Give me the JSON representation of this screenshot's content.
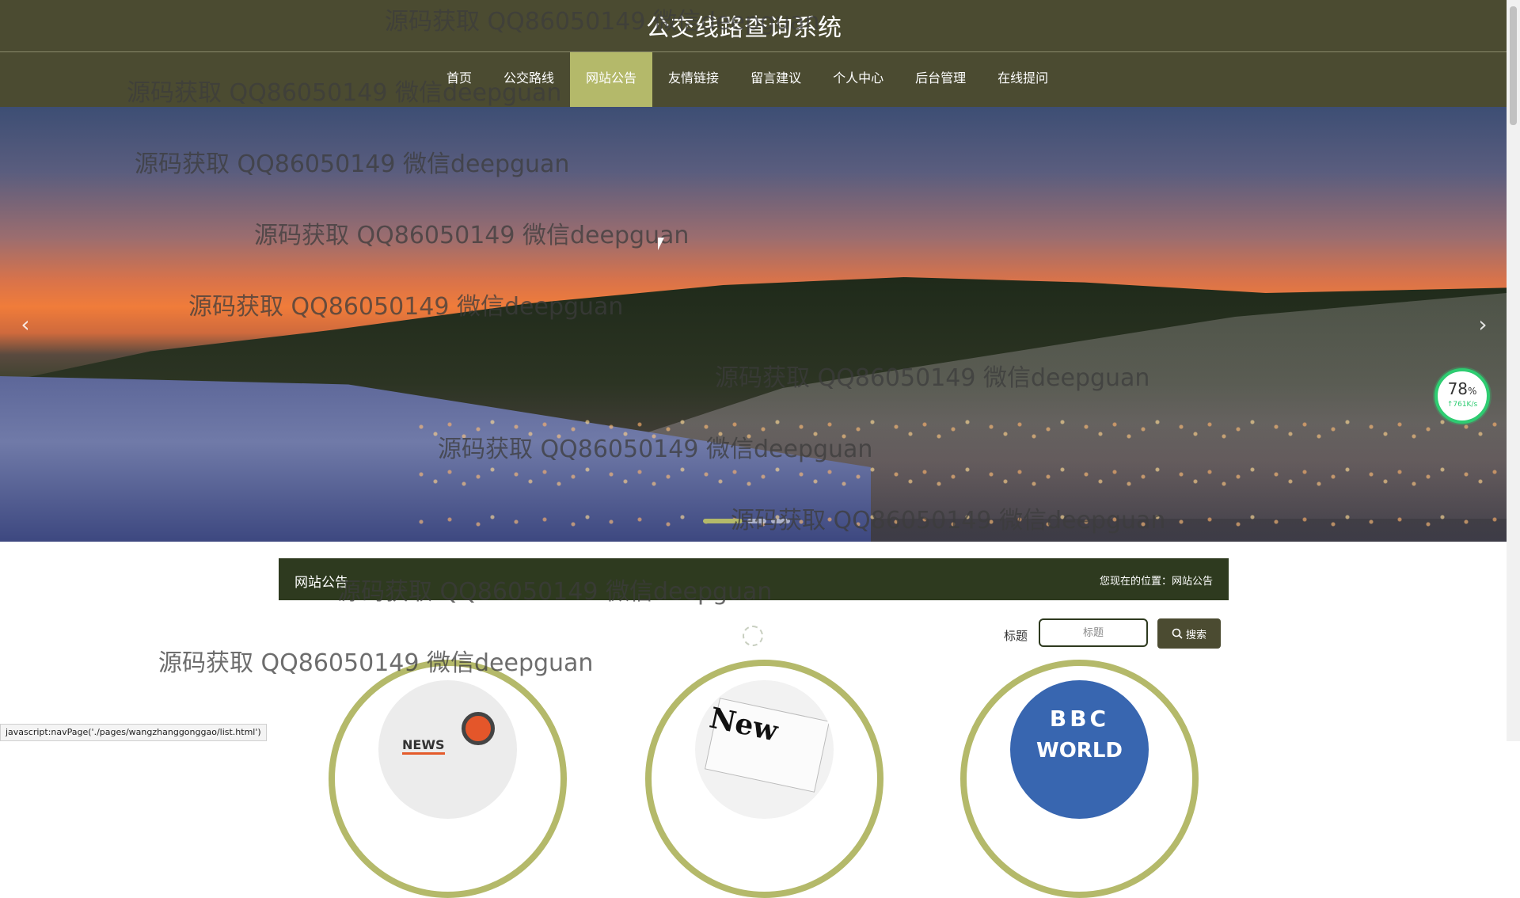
{
  "header": {
    "title": "公交线路查询系统"
  },
  "nav": {
    "items": [
      "首页",
      "公交路线",
      "网站公告",
      "友情链接",
      "留言建议",
      "个人中心",
      "后台管理",
      "在线提问"
    ],
    "active_index": 2
  },
  "banner": {
    "prev_icon": "chevron-left-icon",
    "next_icon": "chevron-right-icon",
    "dots": 3,
    "active_dot": 0
  },
  "speed_widget": {
    "percent": "78",
    "percent_unit": "%",
    "rate": "↑761K/s"
  },
  "section": {
    "title": "网站公告",
    "breadcrumb_prefix": "您现在的位置：",
    "breadcrumb_current": "网站公告"
  },
  "search": {
    "label": "标题",
    "placeholder": "标题",
    "button_label": "搜索",
    "button_icon": "search-icon"
  },
  "cards": [
    {
      "name": "news-card-1",
      "image_text": "NEWS"
    },
    {
      "name": "news-card-2",
      "image_text": "New"
    },
    {
      "name": "bbc-card",
      "image_text": "BBC",
      "image_subtext": "WORLD"
    }
  ],
  "watermark": {
    "text": "源码获取 QQ86050149 微信deepguan"
  },
  "statusbar": {
    "url": "javascript:navPage('./pages/wangzhanggonggao/list.html')"
  },
  "colors": {
    "header_bg": "#4b4b31",
    "nav_active": "#b4b96a",
    "section_bar": "#2e3a1f",
    "card_ring": "#b4b96a"
  }
}
